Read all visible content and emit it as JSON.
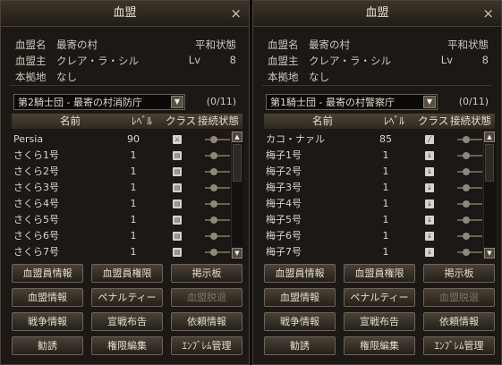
{
  "windows": [
    {
      "title": "血盟",
      "close_icon": "×",
      "info": {
        "name_label": "血盟名",
        "name_value": "最寄の村",
        "state": "平和状態",
        "leader_label": "血盟主",
        "leader_value": "クレア・ラ・シル",
        "lv_label": "Lv",
        "lv_value": "8",
        "base_label": "本拠地",
        "base_value": "なし"
      },
      "knight_select": "第2騎士団 - 最寄の村消防庁",
      "count": "(0/11)",
      "headers": {
        "name": "名前",
        "level": "ﾚﾍﾞﾙ",
        "class": "クラス",
        "connection": "接続状態"
      },
      "members": [
        {
          "name": "Persia",
          "level": "90",
          "class_icon": "sword-class-icon"
        },
        {
          "name": "さくら1号",
          "level": "1",
          "class_icon": "book-class-icon"
        },
        {
          "name": "さくら2号",
          "level": "1",
          "class_icon": "book-class-icon"
        },
        {
          "name": "さくら3号",
          "level": "1",
          "class_icon": "book-class-icon"
        },
        {
          "name": "さくら4号",
          "level": "1",
          "class_icon": "book-class-icon"
        },
        {
          "name": "さくら5号",
          "level": "1",
          "class_icon": "book-class-icon"
        },
        {
          "name": "さくら6号",
          "level": "1",
          "class_icon": "book-class-icon"
        },
        {
          "name": "さくら7号",
          "level": "1",
          "class_icon": "book-class-icon"
        }
      ],
      "buttons": [
        "血盟員情報",
        "血盟員権限",
        "掲示板",
        "血盟情報",
        "ペナルティー",
        "血盟脱退",
        "戦争情報",
        "宣戦布告",
        "依頼情報",
        "勧誘",
        "権限編集",
        "ｴﾝﾌﾞﾚﾑ管理"
      ]
    },
    {
      "title": "血盟",
      "close_icon": "×",
      "info": {
        "name_label": "血盟名",
        "name_value": "最寄の村",
        "state": "平和状態",
        "leader_label": "血盟主",
        "leader_value": "クレア・ラ・シル",
        "lv_label": "Lv",
        "lv_value": "8",
        "base_label": "本拠地",
        "base_value": "なし"
      },
      "knight_select": "第1騎士団 - 最寄の村警察庁",
      "count": "(0/11)",
      "headers": {
        "name": "名前",
        "level": "ﾚﾍﾞﾙ",
        "class": "クラス",
        "connection": "接続状態"
      },
      "members": [
        {
          "name": "カコ・ナァル",
          "level": "85",
          "class_icon": "staff-class-icon"
        },
        {
          "name": "梅子1号",
          "level": "1",
          "class_icon": "dagger-class-icon"
        },
        {
          "name": "梅子2号",
          "level": "1",
          "class_icon": "dagger-class-icon"
        },
        {
          "name": "梅子3号",
          "level": "1",
          "class_icon": "dagger-class-icon"
        },
        {
          "name": "梅子4号",
          "level": "1",
          "class_icon": "dagger-class-icon"
        },
        {
          "name": "梅子5号",
          "level": "1",
          "class_icon": "dagger-class-icon"
        },
        {
          "name": "梅子6号",
          "level": "1",
          "class_icon": "dagger-class-icon"
        },
        {
          "name": "梅子7号",
          "level": "1",
          "class_icon": "dagger-class-icon"
        }
      ],
      "buttons": [
        "血盟員情報",
        "血盟員権限",
        "掲示板",
        "血盟情報",
        "ペナルティー",
        "血盟脱退",
        "戦争情報",
        "宣戦布告",
        "依頼情報",
        "勧誘",
        "権限編集",
        "ｴﾝﾌﾞﾚﾑ管理"
      ]
    }
  ],
  "disabled_button": "血盟脱退",
  "icon_glyphs": {
    "sword-class-icon": "⚔",
    "book-class-icon": "▤",
    "staff-class-icon": "╱",
    "dagger-class-icon": "↓"
  }
}
